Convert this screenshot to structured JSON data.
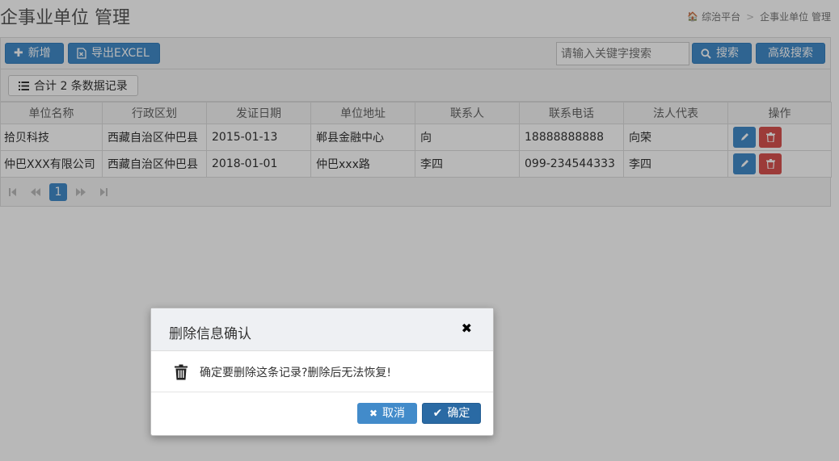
{
  "header": {
    "title": "企事业单位 管理",
    "breadcrumb": {
      "home": "综治平台",
      "current": "企事业单位 管理"
    }
  },
  "toolbar": {
    "add_label": "新增",
    "export_label": "导出EXCEL",
    "search_placeholder": "请输入关键字搜索",
    "search_label": "搜索",
    "advanced_search_label": "高级搜索"
  },
  "summary": {
    "record_count_label": "合计 2 条数据记录"
  },
  "table": {
    "columns": [
      "单位名称",
      "行政区划",
      "发证日期",
      "单位地址",
      "联系人",
      "联系电话",
      "法人代表",
      "操作"
    ],
    "rows": [
      {
        "name": "拾贝科技",
        "region": "西藏自治区仲巴县",
        "date": "2015-01-13",
        "address": "郸县金融中心",
        "contact": "向",
        "phone": "18888888888",
        "legal": "向荣"
      },
      {
        "name": "仲巴XXX有限公司",
        "region": "西藏自治区仲巴县",
        "date": "2018-01-01",
        "address": "仲巴xxx路",
        "contact": "李四",
        "phone": "099-234544333",
        "legal": "李四"
      }
    ]
  },
  "pagination": {
    "current_page": "1"
  },
  "dialog": {
    "title": "删除信息确认",
    "message": "确定要删除这条记录?删除后无法恢复!",
    "cancel_label": "取消",
    "confirm_label": "确定"
  },
  "colors": {
    "primary": "#428bca",
    "danger": "#d9534f",
    "confirm": "#2a6aa4"
  }
}
